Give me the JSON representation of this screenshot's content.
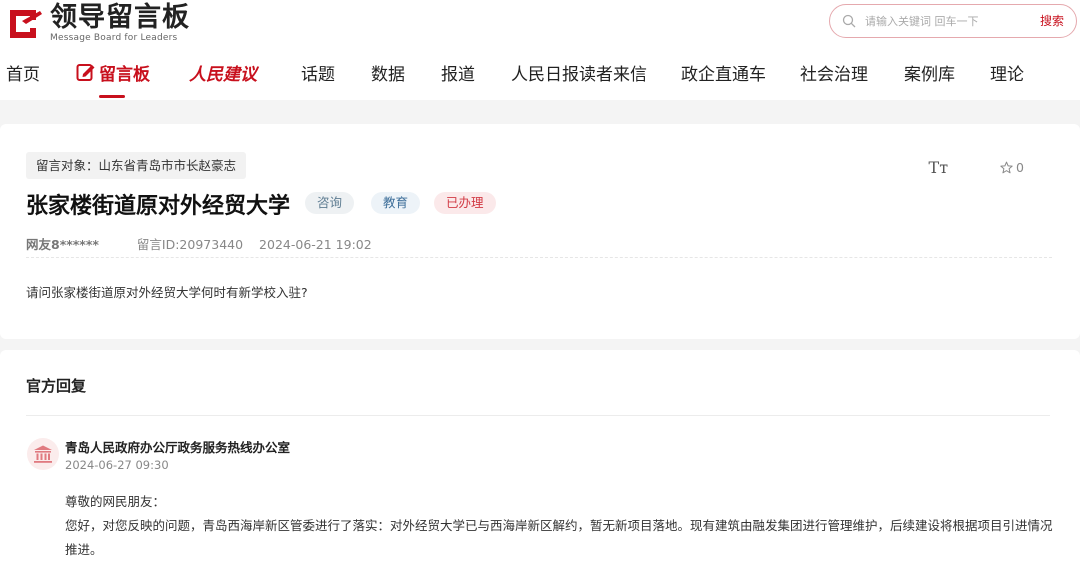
{
  "brand": {
    "title": "领导留言板",
    "subtitle": "Message Board for Leaders",
    "color": "#c8101d"
  },
  "search": {
    "placeholder": "请输入关键词 回车一下",
    "button_label": "搜索"
  },
  "nav": {
    "items": [
      {
        "label": "首页"
      },
      {
        "label": "留言板",
        "icon": "edit-icon"
      },
      {
        "label": "人民建议",
        "icon": "renmin-logo"
      },
      {
        "label": "话题"
      },
      {
        "label": "数据"
      },
      {
        "label": "报道"
      },
      {
        "label": "人民日报读者来信"
      },
      {
        "label": "政企直通车"
      },
      {
        "label": "社会治理"
      },
      {
        "label": "案例库"
      },
      {
        "label": "理论"
      }
    ],
    "active_index": 1
  },
  "message": {
    "target": "留言对象：山东省青岛市市长赵豪志",
    "title": "张家楼街道原对外经贸大学",
    "tags": [
      "咨询",
      "教育",
      "已办理"
    ],
    "author": "网友8******",
    "message_id": "留言ID:20973440",
    "datetime": "2024-06-21 19:02",
    "content": "请问张家楼街道原对外经贸大学何时有新学校入驻?",
    "font_toggle_label": "Tт",
    "favorite_count": "0"
  },
  "reply": {
    "heading": "官方回复",
    "org_name": "青岛人民政府办公厅政务服务热线办公室",
    "datetime": "2024-06-27 09:30",
    "greeting": "尊敬的网民朋友：",
    "body": "您好，对您反映的问题，青岛西海岸新区管委进行了落实：对外经贸大学已与西海岸新区解约，暂无新项目落地。现有建筑由融发集团进行管理维护，后续建设将根据项目引进情况推进。",
    "avatar_icon": "government-building-icon"
  }
}
